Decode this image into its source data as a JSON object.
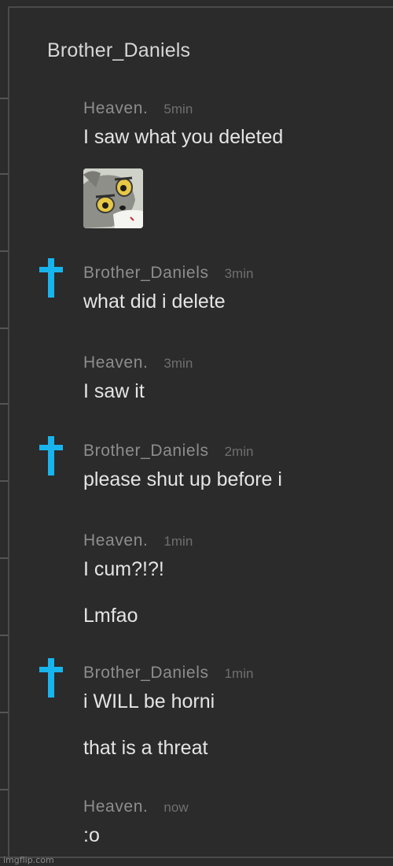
{
  "chat": {
    "title": "Brother_Daniels"
  },
  "messages": [
    {
      "author": "Heaven.",
      "time": "5min",
      "lines": [
        "I saw what you deleted"
      ],
      "has_sticker": true
    },
    {
      "author": "Brother_Daniels",
      "time": "3min",
      "lines": [
        "what did i delete"
      ],
      "icon": "cross-icon"
    },
    {
      "author": "Heaven.",
      "time": "3min",
      "lines": [
        "I saw it"
      ]
    },
    {
      "author": "Brother_Daniels",
      "time": "2min",
      "lines": [
        "please shut up before i"
      ],
      "icon": "cross-icon"
    },
    {
      "author": "Heaven.",
      "time": "1min",
      "lines": [
        "I cum?!?!",
        "Lmfao"
      ]
    },
    {
      "author": "Brother_Daniels",
      "time": "1min",
      "lines": [
        "i WILL be horni",
        "that is a threat"
      ],
      "icon": "cross-icon"
    },
    {
      "author": "Heaven.",
      "time": "now",
      "lines": [
        ":o"
      ]
    }
  ],
  "sticker": {
    "icon": "tom-cat-sticker-icon"
  },
  "colors": {
    "background": "#2b2b2b",
    "cross": "#18b4ee",
    "author": "#8d8d8d",
    "time": "#6f6f6f",
    "text": "#e4e4e4"
  },
  "watermark": "imgflip.com"
}
